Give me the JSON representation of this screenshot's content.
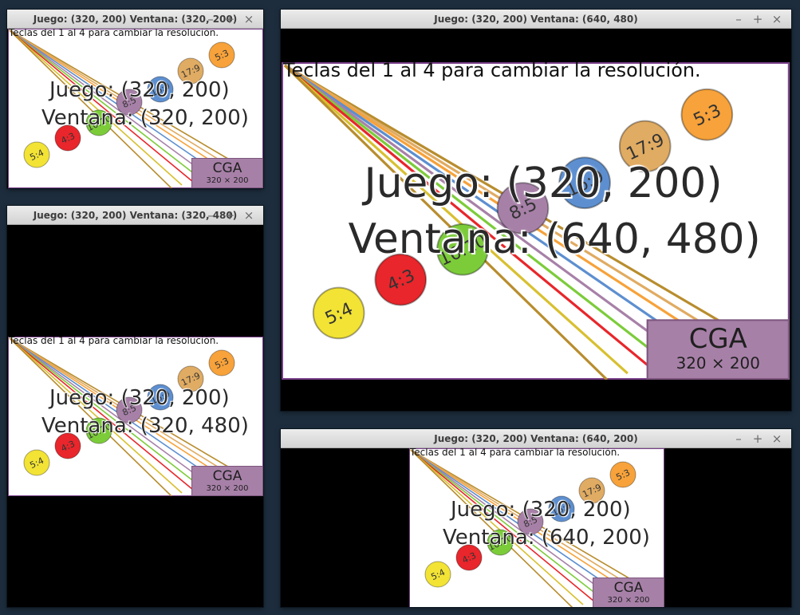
{
  "windows": [
    {
      "id": "w1",
      "title": "Juego: (320, 200) Ventana: (320, 200)",
      "content_text": {
        "juego": "Juego: (320, 200)",
        "ventana": "Ventana: (320, 200)"
      }
    },
    {
      "id": "w2",
      "title": "Juego: (320, 200) Ventana: (320, 480)",
      "content_text": {
        "juego": "Juego: (320, 200)",
        "ventana": "Ventana: (320, 480)"
      }
    },
    {
      "id": "w3",
      "title": "Juego: (320, 200) Ventana: (640, 480)",
      "content_text": {
        "juego": "Juego: (320, 200)",
        "ventana": "Ventana: (640, 480)"
      }
    },
    {
      "id": "w4",
      "title": "Juego: (320, 200) Ventana: (640, 200)",
      "content_text": {
        "juego": "Juego: (320, 200)",
        "ventana": "Ventana: (640, 200)"
      }
    }
  ],
  "game": {
    "hint": "Teclas del 1 al 4 para cambiar la resolución.",
    "badge": {
      "name": "CGA",
      "resolution": "320 × 200"
    },
    "ratios": [
      {
        "label": "5:4",
        "color": "#f2e335"
      },
      {
        "label": "4:3",
        "color": "#e8262b"
      },
      {
        "label": "16:10",
        "color": "#7ccc3a"
      },
      {
        "label": "8:5",
        "color": "#a780a8"
      },
      {
        "label": "16:9",
        "color": "#5d8fd0"
      },
      {
        "label": "17:9",
        "color": "#e0ab62"
      },
      {
        "label": "5:3",
        "color": "#f7a23a"
      }
    ]
  },
  "controls": {
    "minimize": "–",
    "maximize": "+",
    "close": "×"
  }
}
